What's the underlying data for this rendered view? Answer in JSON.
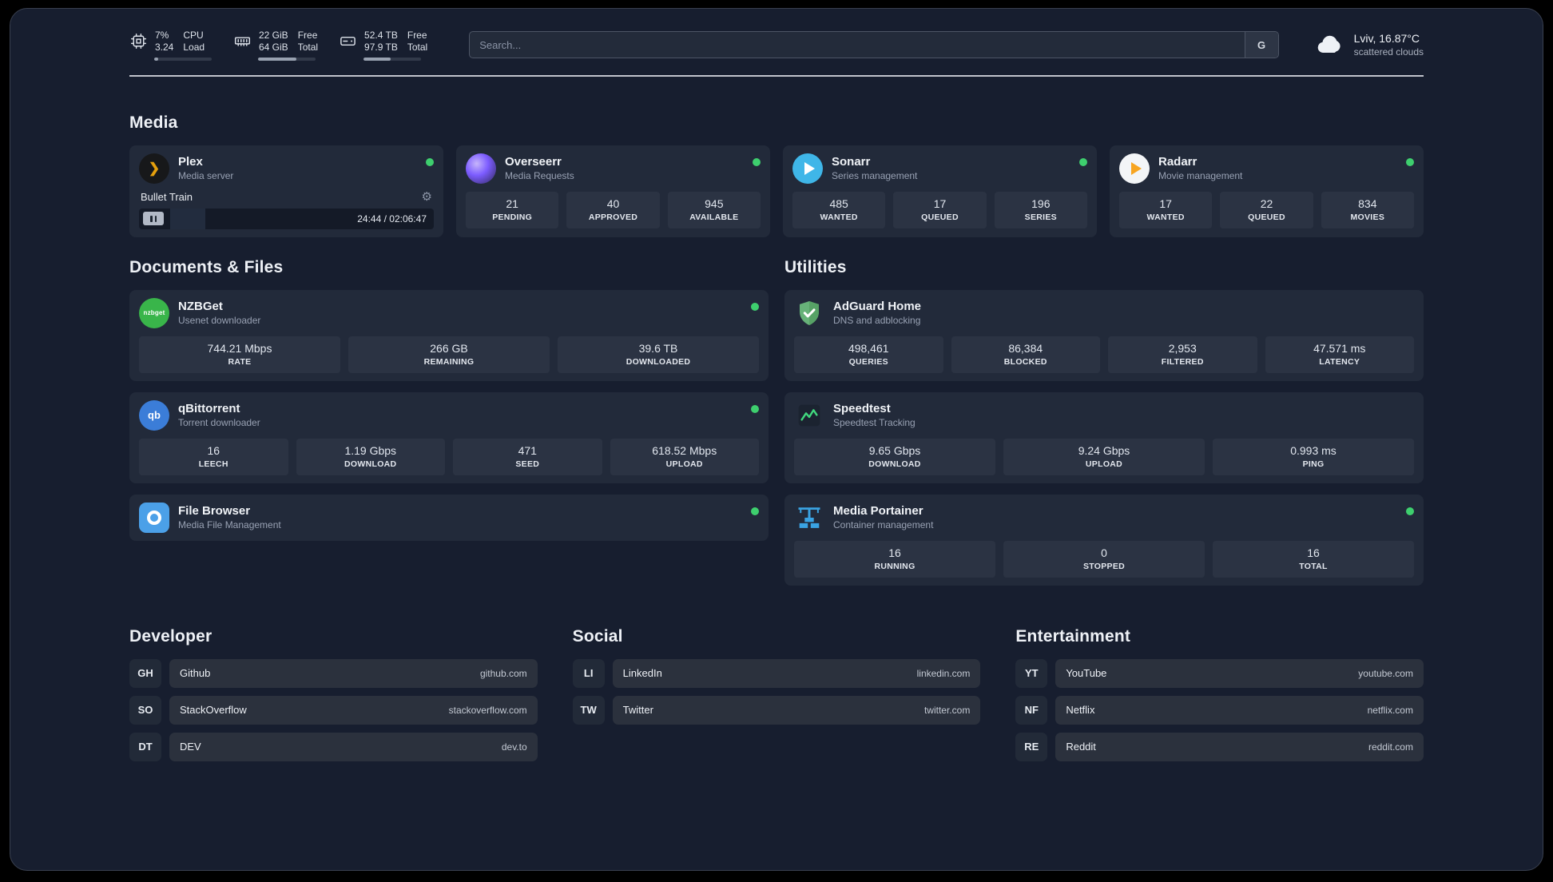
{
  "header": {
    "cpu": {
      "value_primary": "7%",
      "value_secondary": "3.24",
      "label_primary": "CPU",
      "label_secondary": "Load",
      "bar_percent": 7
    },
    "memory": {
      "value_primary": "22 GiB",
      "value_secondary": "64 GiB",
      "label_primary": "Free",
      "label_secondary": "Total",
      "bar_percent": 66
    },
    "disk": {
      "value_primary": "52.4 TB",
      "value_secondary": "97.9 TB",
      "label_primary": "Free",
      "label_secondary": "Total",
      "bar_percent": 47
    },
    "search": {
      "placeholder": "Search...",
      "engine_label": "G"
    },
    "weather": {
      "location": "Lviv, 16.87°C",
      "condition": "scattered clouds"
    }
  },
  "sections": {
    "media": "Media",
    "documents": "Documents & Files",
    "utilities": "Utilities",
    "developer": "Developer",
    "social": "Social",
    "entertainment": "Entertainment"
  },
  "apps": {
    "plex": {
      "name": "Plex",
      "desc": "Media server",
      "now_playing": "Bullet Train",
      "time": "24:44 / 02:06:47",
      "progress_percent": 19.5
    },
    "overseerr": {
      "name": "Overseerr",
      "desc": "Media Requests",
      "stats": [
        {
          "value": "21",
          "label": "PENDING"
        },
        {
          "value": "40",
          "label": "APPROVED"
        },
        {
          "value": "945",
          "label": "AVAILABLE"
        }
      ]
    },
    "sonarr": {
      "name": "Sonarr",
      "desc": "Series management",
      "stats": [
        {
          "value": "485",
          "label": "WANTED"
        },
        {
          "value": "17",
          "label": "QUEUED"
        },
        {
          "value": "196",
          "label": "SERIES"
        }
      ]
    },
    "radarr": {
      "name": "Radarr",
      "desc": "Movie management",
      "stats": [
        {
          "value": "17",
          "label": "WANTED"
        },
        {
          "value": "22",
          "label": "QUEUED"
        },
        {
          "value": "834",
          "label": "MOVIES"
        }
      ]
    },
    "nzbget": {
      "name": "NZBGet",
      "desc": "Usenet downloader",
      "icon_text": "nzbget",
      "stats": [
        {
          "value": "744.21 Mbps",
          "label": "RATE"
        },
        {
          "value": "266 GB",
          "label": "REMAINING"
        },
        {
          "value": "39.6 TB",
          "label": "DOWNLOADED"
        }
      ]
    },
    "qbittorrent": {
      "name": "qBittorrent",
      "desc": "Torrent downloader",
      "icon_text": "qb",
      "stats": [
        {
          "value": "16",
          "label": "LEECH"
        },
        {
          "value": "1.19 Gbps",
          "label": "DOWNLOAD"
        },
        {
          "value": "471",
          "label": "SEED"
        },
        {
          "value": "618.52 Mbps",
          "label": "UPLOAD"
        }
      ]
    },
    "filebrowser": {
      "name": "File Browser",
      "desc": "Media File Management"
    },
    "adguard": {
      "name": "AdGuard Home",
      "desc": "DNS and adblocking",
      "stats": [
        {
          "value": "498,461",
          "label": "QUERIES"
        },
        {
          "value": "86,384",
          "label": "BLOCKED"
        },
        {
          "value": "2,953",
          "label": "FILTERED"
        },
        {
          "value": "47.571 ms",
          "label": "LATENCY"
        }
      ]
    },
    "speedtest": {
      "name": "Speedtest",
      "desc": "Speedtest Tracking",
      "stats": [
        {
          "value": "9.65 Gbps",
          "label": "DOWNLOAD"
        },
        {
          "value": "9.24 Gbps",
          "label": "UPLOAD"
        },
        {
          "value": "0.993 ms",
          "label": "PING"
        }
      ]
    },
    "portainer": {
      "name": "Media Portainer",
      "desc": "Container management",
      "stats": [
        {
          "value": "16",
          "label": "RUNNING"
        },
        {
          "value": "0",
          "label": "STOPPED"
        },
        {
          "value": "16",
          "label": "TOTAL"
        }
      ]
    }
  },
  "links": {
    "developer": [
      {
        "abbr": "GH",
        "name": "Github",
        "url": "github.com"
      },
      {
        "abbr": "SO",
        "name": "StackOverflow",
        "url": "stackoverflow.com"
      },
      {
        "abbr": "DT",
        "name": "DEV",
        "url": "dev.to"
      }
    ],
    "social": [
      {
        "abbr": "LI",
        "name": "LinkedIn",
        "url": "linkedin.com"
      },
      {
        "abbr": "TW",
        "name": "Twitter",
        "url": "twitter.com"
      }
    ],
    "entertainment": [
      {
        "abbr": "YT",
        "name": "YouTube",
        "url": "youtube.com"
      },
      {
        "abbr": "NF",
        "name": "Netflix",
        "url": "netflix.com"
      },
      {
        "abbr": "RE",
        "name": "Reddit",
        "url": "reddit.com"
      }
    ]
  },
  "colors": {
    "status_online": "#3ecf6e",
    "plex_accent": "#e5a00d",
    "board_background": "#171e2f",
    "card_background": "#222a3a"
  },
  "icons": {
    "cpu": "chip-icon",
    "memory": "ram-icon",
    "disk": "hard-drive-icon",
    "weather": "cloud-icon",
    "settings": "⚙",
    "pause": "❚❚",
    "plex_glyph": "❯"
  }
}
